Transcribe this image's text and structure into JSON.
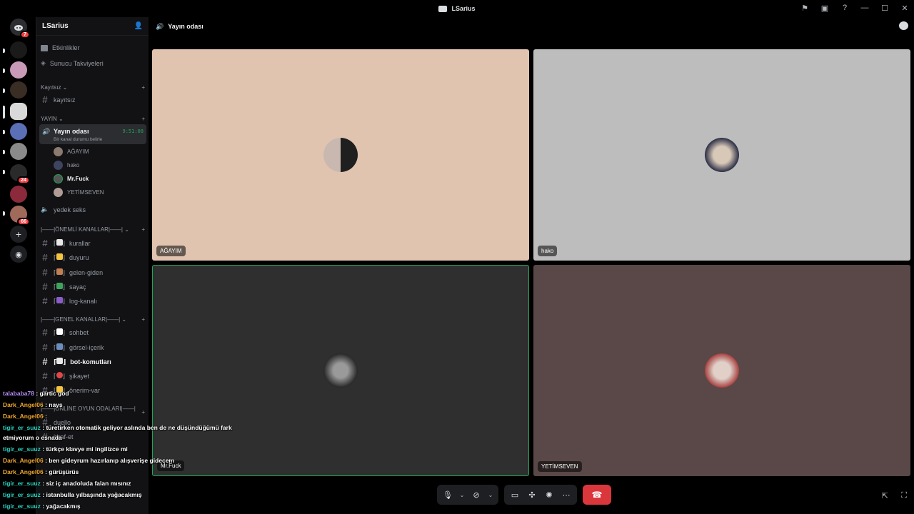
{
  "window": {
    "title": "LSarius"
  },
  "server": {
    "name": "LSarius",
    "top_items": [
      {
        "label": "Etkinlikler",
        "icon": "calendar-icon"
      },
      {
        "label": "Sunucu Takviyeleri",
        "icon": "boost-icon"
      }
    ],
    "categories": {
      "kayitsiz": {
        "label": "Kayıtsız",
        "channels": [
          "kayıtsız"
        ]
      },
      "yayin": {
        "label": "YAYIN"
      },
      "onemli": {
        "label": "|——|ÖNEMLİ KANALLAR|——|"
      },
      "genel": {
        "label": "|——|GENEL KANALLAR|——|"
      },
      "oyun": {
        "label": "|——|ONLİNE OYUN ODALARI|——|"
      }
    },
    "voice_channel": {
      "name": "Yayın odası",
      "status_placeholder": "Bir kanal durumu belirle",
      "time": "9:51:08",
      "members": [
        "AĞAYIM",
        "hako",
        "Mr.Fuck",
        "YETİMSEVEN"
      ]
    },
    "voice_channel_2": "yedek seks",
    "onemli_channels": [
      "kurallar",
      "duyuru",
      "gelen-giden",
      "sayaç",
      "log-kanalı"
    ],
    "genel_channels": [
      "sohbet",
      "görsel-içerik",
      "bot-komutları",
      "şikayet",
      "önerim-var"
    ],
    "oyun_channels": [
      "duello",
      "itiraf-et"
    ]
  },
  "guild_badges": {
    "dm": "7",
    "g1": "24",
    "g2": "66"
  },
  "call": {
    "header": "Yayın odası",
    "tiles": [
      {
        "name": "AĞAYIM",
        "bg": "#e0c4b0",
        "avatar": "#3a3330"
      },
      {
        "name": "hako",
        "bg": "#bdbdbd",
        "avatar": "#2b2f45"
      },
      {
        "name": "Mr.Fuck",
        "bg": "#2f2f2f",
        "avatar": "#6d6d6d",
        "speaking": true
      },
      {
        "name": "YETİMSEVEN",
        "bg": "#594847",
        "avatar": "#c9b7b0"
      }
    ],
    "accent": "#23a55a",
    "hangup_color": "#da373c"
  },
  "chat_overlay": [
    {
      "user": "talababa78",
      "text": " : gartic god",
      "color": "purple"
    },
    {
      "user": "Dark_Angel06",
      "text": " : nays",
      "color": "orange"
    },
    {
      "user": "Dark_Angel06",
      "text": " : ",
      "color": "orange"
    },
    {
      "user": "tigir_er_suuz",
      "text": " : türetirken otomatik geliyor aslında ben de ne düşündüğümü fark",
      "color": "teal"
    },
    {
      "user": "",
      "text": "etmiyorum o esnada",
      "color": "white"
    },
    {
      "user": "tigir_er_suuz",
      "text": " : türkçe klavye mi ingilizce mi",
      "color": "teal"
    },
    {
      "user": "Dark_Angel06",
      "text": " : ben gideyrum hazırlanıp alışverişe gidecem",
      "color": "orange"
    },
    {
      "user": "Dark_Angel06",
      "text": " : gürüşürüs",
      "color": "orange"
    },
    {
      "user": "tigir_er_suuz",
      "text": " : siz iç anadoluda falan mısınız",
      "color": "teal"
    },
    {
      "user": "tigir_er_suuz",
      "text": " : istanbulla yılbaşında yağacakmış",
      "color": "teal"
    },
    {
      "user": "tigir_er_suuz",
      "text": " : yağacakmış",
      "color": "teal"
    }
  ]
}
